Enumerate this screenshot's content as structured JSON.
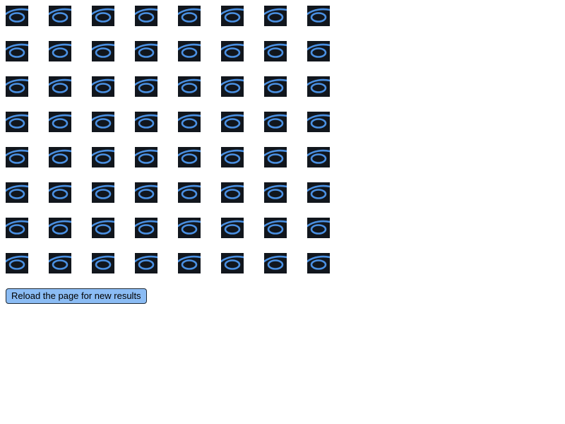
{
  "colors": {
    "tile_background": "#11161d",
    "icon_stroke": "#4a90e2",
    "button_background": "#8bbcf4",
    "button_border": "#1e2a36",
    "page_background": "#ffffff"
  },
  "grid": {
    "rows": 8,
    "columns": 8,
    "tile_icon": "eye-swirl-icon"
  },
  "reload_button": {
    "label": "Reload the page for new results"
  }
}
